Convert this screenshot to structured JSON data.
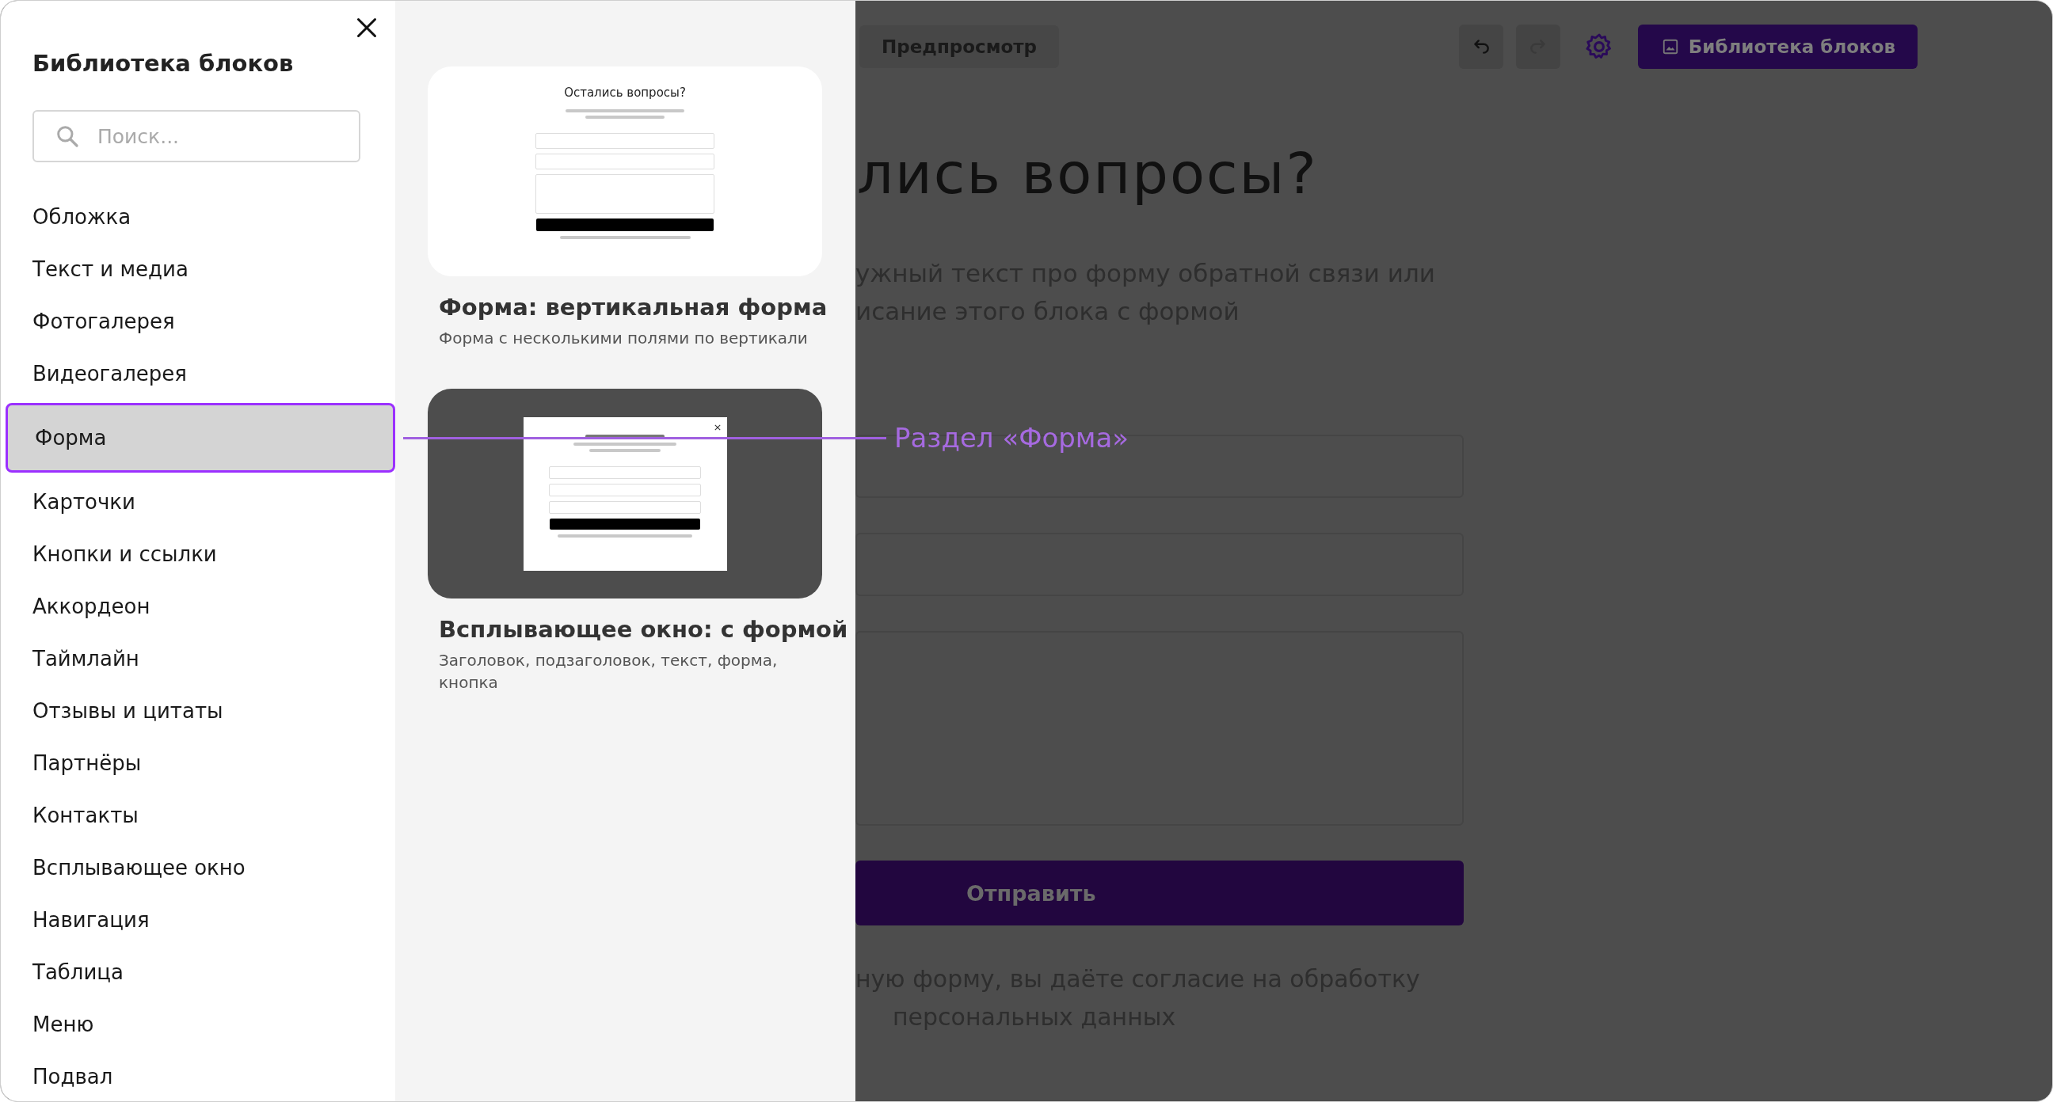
{
  "sidebar": {
    "title": "Библиотека блоков",
    "search": {
      "placeholder": "Поиск..."
    },
    "items": [
      {
        "label": "Обложка",
        "selected": false
      },
      {
        "label": "Текст и медиа",
        "selected": false
      },
      {
        "label": "Фотогалерея",
        "selected": false
      },
      {
        "label": "Видеогалерея",
        "selected": false
      },
      {
        "label": "Форма",
        "selected": true
      },
      {
        "label": "Карточки",
        "selected": false
      },
      {
        "label": "Кнопки и ссылки",
        "selected": false
      },
      {
        "label": "Аккордеон",
        "selected": false
      },
      {
        "label": "Таймлайн",
        "selected": false
      },
      {
        "label": "Отзывы и цитаты",
        "selected": false
      },
      {
        "label": "Партнёры",
        "selected": false
      },
      {
        "label": "Контакты",
        "selected": false
      },
      {
        "label": "Всплывающее окно",
        "selected": false
      },
      {
        "label": "Навигация",
        "selected": false
      },
      {
        "label": "Таблица",
        "selected": false
      },
      {
        "label": "Меню",
        "selected": false
      },
      {
        "label": "Подвал",
        "selected": false
      }
    ]
  },
  "cards": [
    {
      "kind": "inline",
      "preview_heading": "Остались вопросы?",
      "title": "Форма: вертикальная форма",
      "subtitle": "Форма с несколькими полями по вертикали"
    },
    {
      "kind": "popup",
      "title": "Всплывающее окно: с формой",
      "subtitle": "Заголовок, подзаголовок, текст, форма, кнопка"
    }
  ],
  "annotation": {
    "label": "Раздел «Форма»"
  },
  "editor": {
    "toolbar": {
      "preview_button": "Предпросмотр",
      "library_button": "Библиотека блоков"
    },
    "heading": "лись вопросы?",
    "description_lines": [
      "ужный текст про форму обратной связи или",
      "исание этого блока с формой"
    ],
    "submit_button": "Отправить",
    "consent_lines": [
      "ную форму, вы даёте согласие на обработку",
      "персональных данных"
    ]
  }
}
